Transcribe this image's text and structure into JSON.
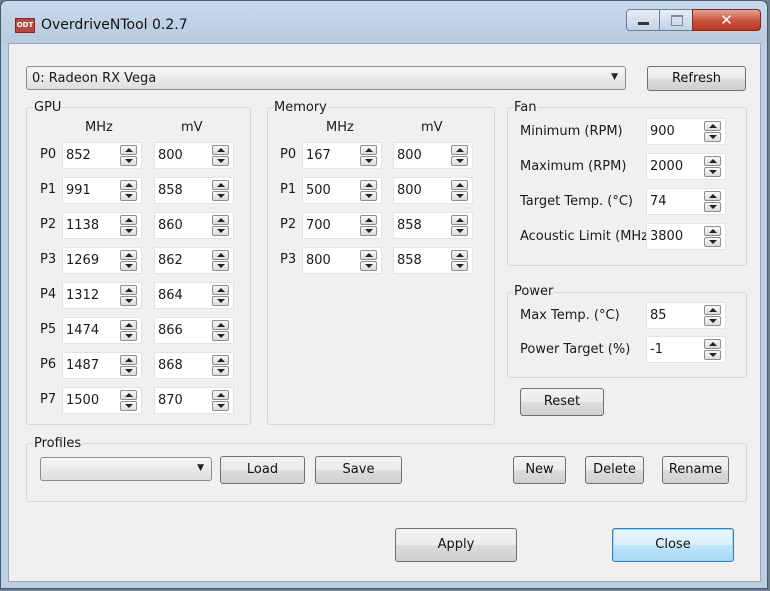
{
  "window": {
    "title": "OverdriveNTool 0.2.7",
    "icon_text": "ODT"
  },
  "gpu_selector": {
    "value": "0: Radeon RX Vega"
  },
  "refresh_button": "Refresh",
  "gpu": {
    "title": "GPU",
    "col_mhz": "MHz",
    "col_mv": "mV",
    "states": [
      {
        "label": "P0",
        "mhz": "852",
        "mv": "800"
      },
      {
        "label": "P1",
        "mhz": "991",
        "mv": "858"
      },
      {
        "label": "P2",
        "mhz": "1138",
        "mv": "860"
      },
      {
        "label": "P3",
        "mhz": "1269",
        "mv": "862"
      },
      {
        "label": "P4",
        "mhz": "1312",
        "mv": "864"
      },
      {
        "label": "P5",
        "mhz": "1474",
        "mv": "866"
      },
      {
        "label": "P6",
        "mhz": "1487",
        "mv": "868"
      },
      {
        "label": "P7",
        "mhz": "1500",
        "mv": "870"
      }
    ]
  },
  "memory": {
    "title": "Memory",
    "col_mhz": "MHz",
    "col_mv": "mV",
    "states": [
      {
        "label": "P0",
        "mhz": "167",
        "mv": "800"
      },
      {
        "label": "P1",
        "mhz": "500",
        "mv": "800"
      },
      {
        "label": "P2",
        "mhz": "700",
        "mv": "858"
      },
      {
        "label": "P3",
        "mhz": "800",
        "mv": "858"
      }
    ]
  },
  "fan": {
    "title": "Fan",
    "rows": [
      {
        "label": "Minimum (RPM)",
        "value": "900"
      },
      {
        "label": "Maximum (RPM)",
        "value": "2000"
      },
      {
        "label": "Target Temp. (°C)",
        "value": "74"
      },
      {
        "label": "Acoustic Limit (MHz)",
        "value": "3800"
      }
    ]
  },
  "power": {
    "title": "Power",
    "rows": [
      {
        "label": "Max Temp. (°C)",
        "value": "85"
      },
      {
        "label": "Power Target (%)",
        "value": "-1"
      }
    ]
  },
  "reset_button": "Reset",
  "profiles": {
    "title": "Profiles",
    "selected": "",
    "load": "Load",
    "save": "Save",
    "new": "New",
    "delete": "Delete",
    "rename": "Rename"
  },
  "apply_button": "Apply",
  "close_button": "Close"
}
